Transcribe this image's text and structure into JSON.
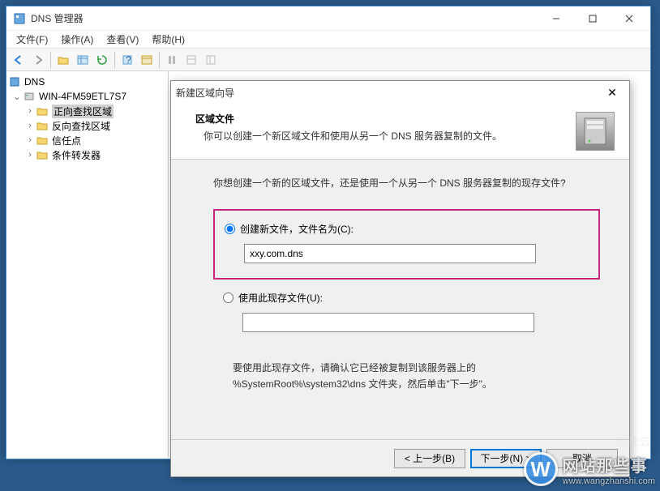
{
  "main": {
    "title": "DNS 管理器",
    "menus": {
      "file": "文件(F)",
      "action": "操作(A)",
      "view": "查看(V)",
      "help": "帮助(H)"
    }
  },
  "tree": {
    "root": "DNS",
    "server": "WIN-4FM59ETL7S7",
    "nodes": {
      "fwd": "正向查找区域",
      "rev": "反向查找区域",
      "trust": "信任点",
      "cond": "条件转发器"
    }
  },
  "wizard": {
    "title": "新建区域向导",
    "head1": "区域文件",
    "head2": "你可以创建一个新区域文件和使用从另一个 DNS 服务器复制的文件。",
    "prompt": "你想创建一个新的区域文件，还是使用一个从另一个 DNS 服务器复制的现存文件?",
    "opt1": "创建新文件，文件名为(C):",
    "opt1val": "xxy.com.dns",
    "opt2": "使用此现存文件(U):",
    "opt2val": "",
    "note1": "要使用此现存文件，请确认它已经被复制到该服务器上的",
    "note2": "%SystemRoot%\\system32\\dns 文件夹，然后单击\"下一步\"。",
    "buttons": {
      "back": "< 上一步(B)",
      "next": "下一步(N) >",
      "cancel": "取消"
    }
  },
  "watermark": {
    "letter": "W",
    "text": "网站那些事",
    "url": "www.wangzhanshi.com",
    "sub": "亿速云"
  }
}
